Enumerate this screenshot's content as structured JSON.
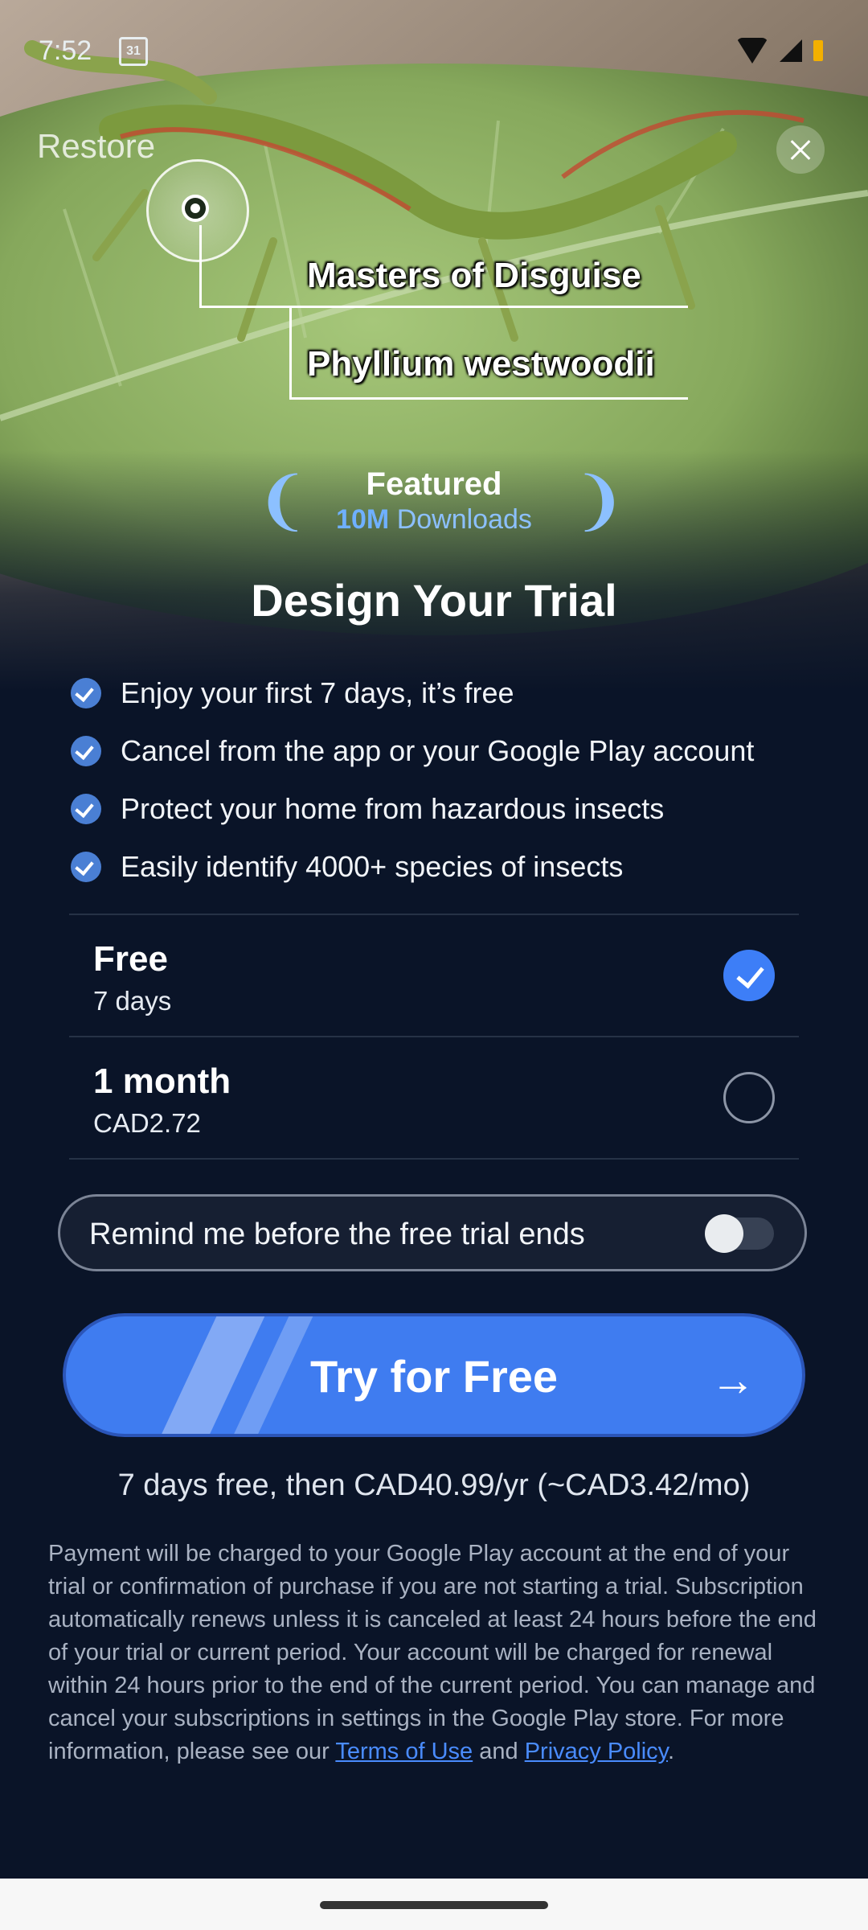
{
  "status": {
    "time": "7:52",
    "calendar_day": "31"
  },
  "header": {
    "restore": "Restore"
  },
  "annotation": {
    "line1": "Masters of Disguise",
    "line2": "Phyllium westwoodii"
  },
  "featured": {
    "title": "Featured",
    "count": "10M",
    "downloads": "Downloads"
  },
  "title": "Design Your Trial",
  "benefits": [
    "Enjoy your first 7 days, it’s free",
    "Cancel from the app or your Google Play account",
    "Protect your home from hazardous insects",
    "Easily identify 4000+ species of insects"
  ],
  "plans": [
    {
      "name": "Free",
      "detail": "7 days",
      "selected": true
    },
    {
      "name": "1 month",
      "detail": "CAD2.72",
      "selected": false
    }
  ],
  "reminder": {
    "label": "Remind me before the free trial ends",
    "enabled": false
  },
  "cta": {
    "label": "Try for Free"
  },
  "price_note": "7 days free, then CAD40.99/yr (~CAD3.42/mo)",
  "legal": {
    "text": "Payment will be charged to your Google Play account at the end of your trial or confirmation of purchase if you are not starting a trial. Subscription automatically renews unless it is canceled at least 24 hours before the end of your trial or current period. Your account will be charged for renewal within 24 hours prior to the end of the current period. You can manage and cancel your subscriptions in settings in the Google Play store. For more information, please see our ",
    "terms": "Terms of Use",
    "and": " and ",
    "privacy": "Privacy Policy",
    "end": "."
  },
  "colors": {
    "accent": "#3f7cf0",
    "background": "#0a1428",
    "check": "#4a7fd4"
  }
}
